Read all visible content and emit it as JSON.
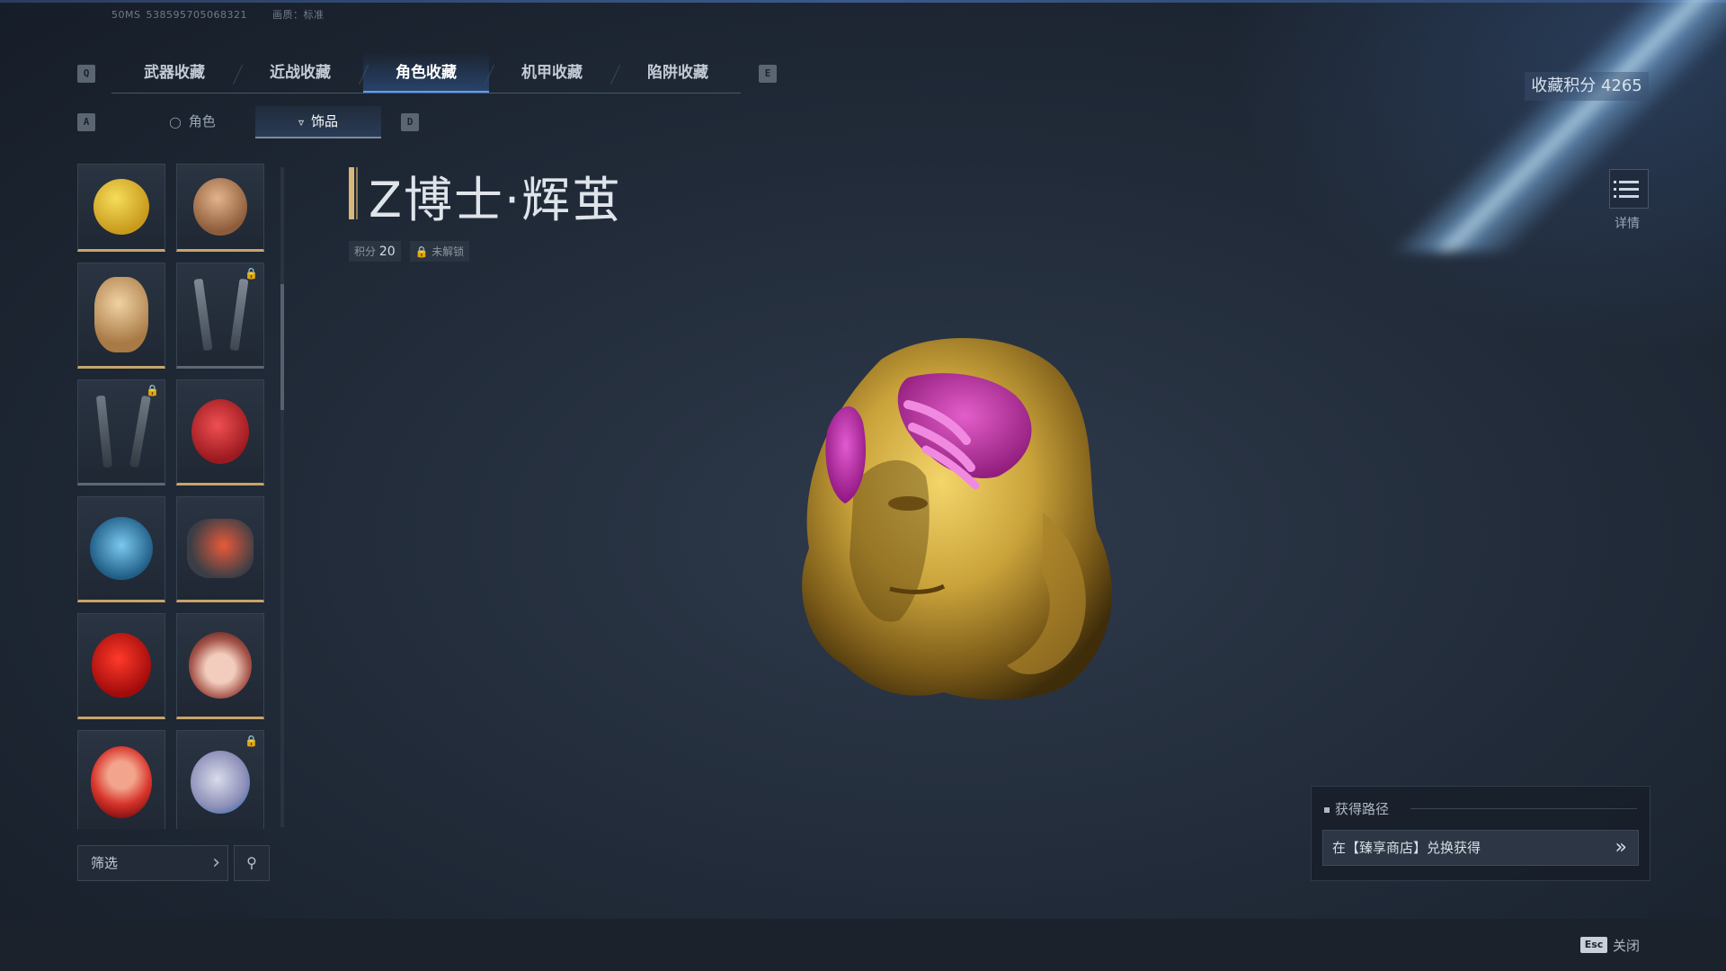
{
  "hud": {
    "ping": "50MS",
    "uid": "538595705068321",
    "quality": "画质：标准"
  },
  "keys": {
    "prev_tab": "Q",
    "next_tab": "E",
    "prev_sub": "A",
    "next_sub": "D",
    "esc": "Esc"
  },
  "tabs": [
    {
      "label": "武器收藏",
      "active": false
    },
    {
      "label": "近战收藏",
      "active": false
    },
    {
      "label": "角色收藏",
      "active": true
    },
    {
      "label": "机甲收藏",
      "active": false
    },
    {
      "label": "陷阱收藏",
      "active": false
    }
  ],
  "subtabs": [
    {
      "label": "角色",
      "icon": "character-icon",
      "active": false
    },
    {
      "label": "饰品",
      "icon": "accessory-icon",
      "active": true
    }
  ],
  "collection_score": "收藏积分 4265",
  "item": {
    "name": "Z博士·辉茧",
    "score_label": "积分",
    "score": "20",
    "status": "未解锁"
  },
  "detail_label": "详情",
  "grid_items": [
    {
      "name": "frog-accessory",
      "locked": false,
      "color": "#e9c23a"
    },
    {
      "name": "monk-accessory",
      "locked": false,
      "color": "#b98b63"
    },
    {
      "name": "bear-accessory",
      "locked": false,
      "color": "#d8a86b"
    },
    {
      "name": "dagger-pair-accessory",
      "locked": true,
      "color": "#56616d"
    },
    {
      "name": "blade-pair-accessory",
      "locked": true,
      "color": "#4c5763"
    },
    {
      "name": "red-robot-accessory",
      "locked": false,
      "color": "#d8363a"
    },
    {
      "name": "blue-mask-accessory",
      "locked": false,
      "color": "#3a8fc4"
    },
    {
      "name": "red-visor-accessory",
      "locked": false,
      "color": "#c9352a"
    },
    {
      "name": "red-hood-accessory",
      "locked": false,
      "color": "#e01818"
    },
    {
      "name": "girl-head-accessory",
      "locked": false,
      "color": "#a8584e"
    },
    {
      "name": "pig-accessory",
      "locked": false,
      "color": "#d8352c"
    },
    {
      "name": "unicorn-accessory",
      "locked": true,
      "color": "#9aa3c2"
    }
  ],
  "filter_label": "筛选",
  "acquisition": {
    "title": "获得路径",
    "method": "在【臻享商店】兑换获得"
  },
  "close_label": "关闭",
  "colors": {
    "accent_gold": "#d9b67a",
    "accent_blue": "#5aa0ff",
    "head_gold": "#c9a43a",
    "hand_magenta": "#c027a8"
  }
}
